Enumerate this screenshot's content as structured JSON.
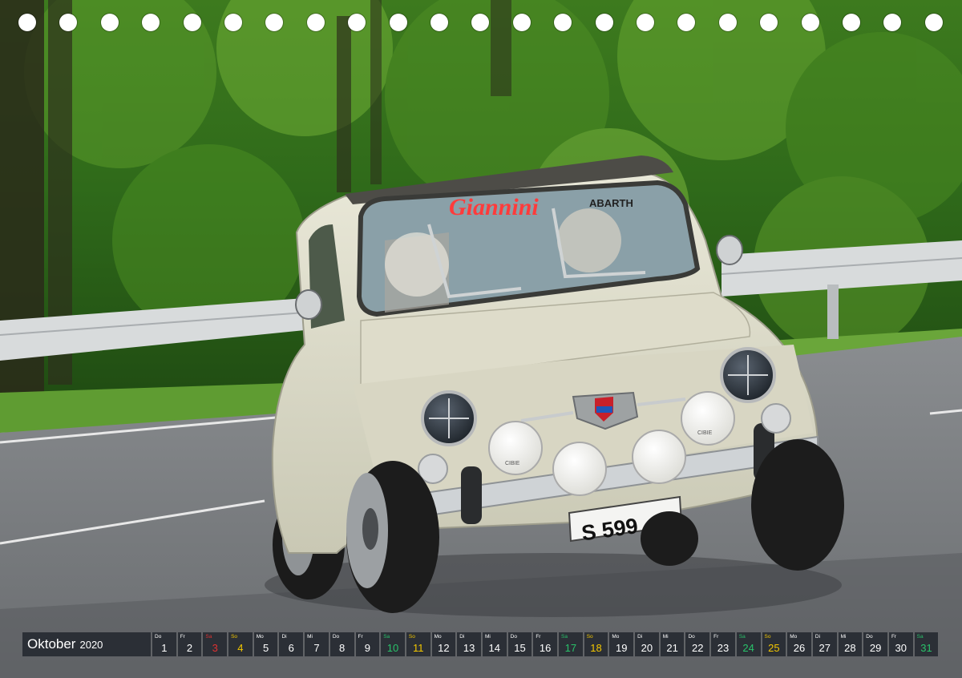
{
  "photo": {
    "plate_text": "S 599",
    "windshield_banner": "Giannini",
    "visor_text": "ABARTH",
    "lamp_text": "CIBIE"
  },
  "calendar": {
    "month": "Oktober",
    "year": "2020",
    "days": [
      {
        "n": "1",
        "d": "Do",
        "t": "wd"
      },
      {
        "n": "2",
        "d": "Fr",
        "t": "wd"
      },
      {
        "n": "3",
        "d": "Sa",
        "t": "hol"
      },
      {
        "n": "4",
        "d": "So",
        "t": "sat"
      },
      {
        "n": "5",
        "d": "Mo",
        "t": "wd"
      },
      {
        "n": "6",
        "d": "Di",
        "t": "wd"
      },
      {
        "n": "7",
        "d": "Mi",
        "t": "wd"
      },
      {
        "n": "8",
        "d": "Do",
        "t": "wd"
      },
      {
        "n": "9",
        "d": "Fr",
        "t": "wd"
      },
      {
        "n": "10",
        "d": "Sa",
        "t": "sun"
      },
      {
        "n": "11",
        "d": "So",
        "t": "sat"
      },
      {
        "n": "12",
        "d": "Mo",
        "t": "wd"
      },
      {
        "n": "13",
        "d": "Di",
        "t": "wd"
      },
      {
        "n": "14",
        "d": "Mi",
        "t": "wd"
      },
      {
        "n": "15",
        "d": "Do",
        "t": "wd"
      },
      {
        "n": "16",
        "d": "Fr",
        "t": "wd"
      },
      {
        "n": "17",
        "d": "Sa",
        "t": "sun"
      },
      {
        "n": "18",
        "d": "So",
        "t": "sat"
      },
      {
        "n": "19",
        "d": "Mo",
        "t": "wd"
      },
      {
        "n": "20",
        "d": "Di",
        "t": "wd"
      },
      {
        "n": "21",
        "d": "Mi",
        "t": "wd"
      },
      {
        "n": "22",
        "d": "Do",
        "t": "wd"
      },
      {
        "n": "23",
        "d": "Fr",
        "t": "wd"
      },
      {
        "n": "24",
        "d": "Sa",
        "t": "sun"
      },
      {
        "n": "25",
        "d": "So",
        "t": "sat"
      },
      {
        "n": "26",
        "d": "Mo",
        "t": "wd"
      },
      {
        "n": "27",
        "d": "Di",
        "t": "wd"
      },
      {
        "n": "28",
        "d": "Mi",
        "t": "wd"
      },
      {
        "n": "29",
        "d": "Do",
        "t": "wd"
      },
      {
        "n": "30",
        "d": "Fr",
        "t": "wd"
      },
      {
        "n": "31",
        "d": "Sa",
        "t": "sun"
      }
    ]
  }
}
